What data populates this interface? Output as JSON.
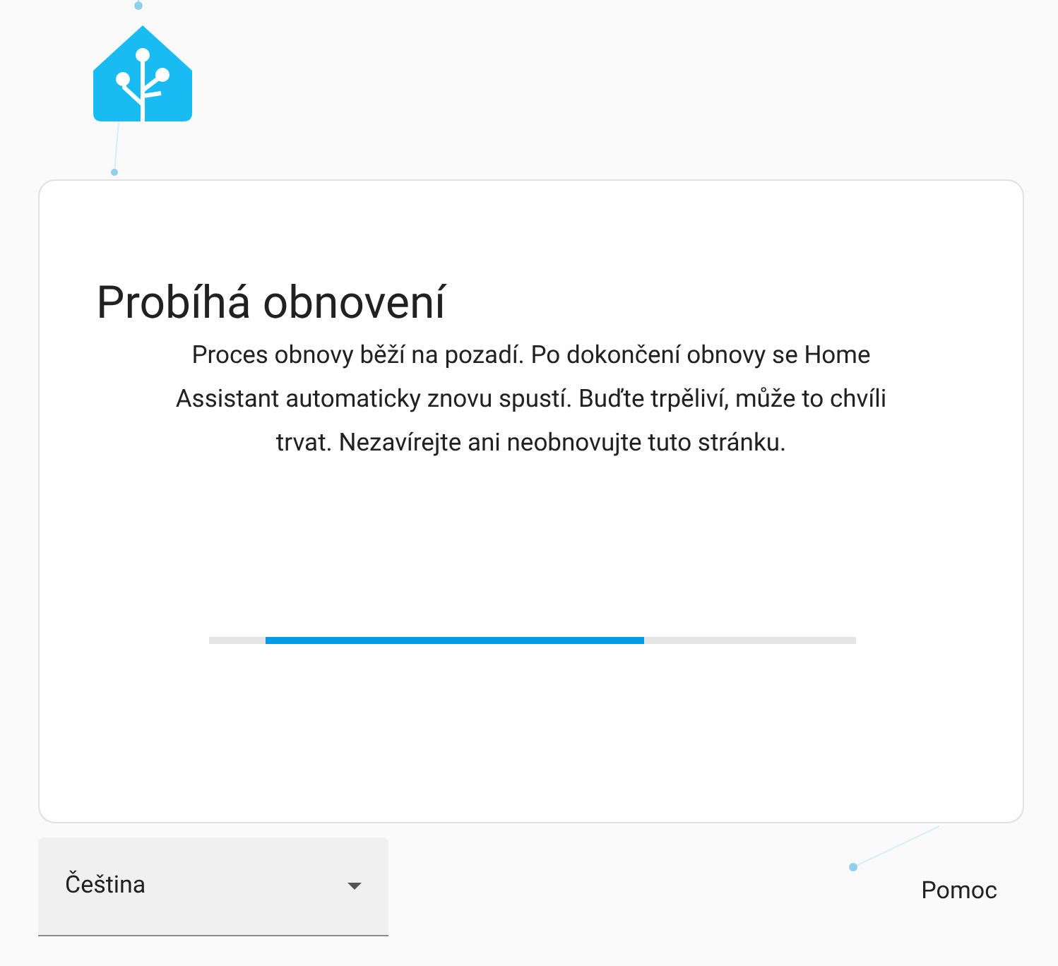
{
  "title": "Probíhá obnovení",
  "message": "Proces obnovy běží na pozadí. Po dokončení obnovy se Home Assistant automaticky znovu spustí. Buďte trpěliví, může to chvíli trvat. Nezavírejte ani neobnovujte tuto stránku.",
  "language_select": {
    "value": "Čeština"
  },
  "help_link": "Pomoc"
}
